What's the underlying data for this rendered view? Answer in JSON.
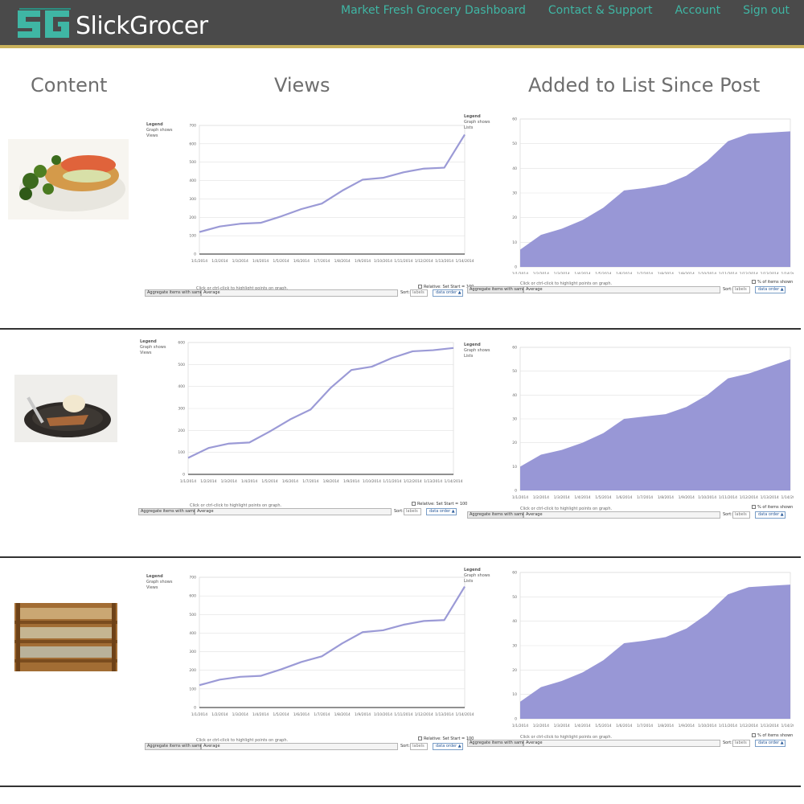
{
  "header": {
    "brand": "SlickGrocer",
    "nav": [
      "Market Fresh Grocery Dashboard",
      "Contact & Support",
      "Account",
      "Sign out"
    ]
  },
  "columns": {
    "content": "Content",
    "views": "Views",
    "lists": "Added to List Since Post"
  },
  "colors": {
    "header_bg": "#4a4a4a",
    "accent_teal": "#3fb6a4",
    "rule_gold": "#c9b15c",
    "views_line": "#9b9ad6",
    "lists_area": "#9897d6"
  },
  "views_legend": [
    "Legend",
    "Graph shows",
    "Views"
  ],
  "lists_legend": [
    "Legend",
    "Graph shows",
    "Lists"
  ],
  "controls": {
    "hint": "Click or ctrl-click to highlight points on graph.",
    "relative_label": "Relative: Set Start = 100",
    "percent_label": "% of items shown",
    "aggregate_label": "Aggregate items with same label:",
    "aggregate_value": "Average",
    "sort_label": "Sort:",
    "sort_value": "labels",
    "order_button": "data order ▲"
  },
  "rows": [
    {
      "thumbnail": "plated-dish-icon"
    },
    {
      "thumbnail": "dessert-plate-icon"
    },
    {
      "thumbnail": "cheese-shelves-icon"
    }
  ],
  "chart_data": [
    {
      "type": "line",
      "ylim": [
        0,
        700
      ],
      "yticks": [
        "0",
        "100",
        "200",
        "300",
        "400",
        "500",
        "600",
        "700"
      ],
      "x": [
        "1/1/2014",
        "1/2/2014",
        "1/3/2014",
        "1/4/2014",
        "1/5/2014",
        "1/6/2014",
        "1/7/2014",
        "1/8/2014",
        "1/9/2014",
        "1/10/2014",
        "1/11/2014",
        "1/12/2014",
        "1/13/2014",
        "1/14/2014"
      ],
      "values": [
        120,
        150,
        165,
        170,
        205,
        245,
        275,
        345,
        405,
        415,
        445,
        465,
        470,
        650
      ]
    },
    {
      "type": "area",
      "ylim": [
        0,
        60
      ],
      "yticks": [
        "0",
        "10",
        "20",
        "30",
        "40",
        "50",
        "60"
      ],
      "x": [
        "1/1/2014",
        "1/2/2014",
        "1/3/2014",
        "1/4/2014",
        "1/5/2014",
        "1/6/2014",
        "1/7/2014",
        "1/8/2014",
        "1/9/2014",
        "1/10/2014",
        "1/11/2014",
        "1/12/2014",
        "1/13/2014",
        "1/14/2014"
      ],
      "values": [
        7,
        13,
        15.5,
        19,
        24,
        31,
        32,
        33.5,
        37,
        43,
        51,
        54,
        54.5,
        55
      ]
    },
    {
      "type": "line",
      "ylim": [
        0,
        600
      ],
      "yticks": [
        "0",
        "100",
        "200",
        "300",
        "400",
        "500",
        "600"
      ],
      "x": [
        "1/1/2014",
        "1/2/2014",
        "1/3/2014",
        "1/4/2014",
        "1/5/2014",
        "1/6/2014",
        "1/7/2014",
        "1/8/2014",
        "1/9/2014",
        "1/10/2014",
        "1/11/2014",
        "1/12/2014",
        "1/13/2014",
        "1/14/2014"
      ],
      "values": [
        75,
        120,
        140,
        145,
        195,
        250,
        295,
        395,
        475,
        490,
        530,
        560,
        565,
        575
      ]
    },
    {
      "type": "area",
      "ylim": [
        0,
        60
      ],
      "yticks": [
        "0",
        "10",
        "20",
        "30",
        "40",
        "50",
        "60"
      ],
      "x": [
        "1/1/2014",
        "1/2/2014",
        "1/3/2014",
        "1/4/2014",
        "1/5/2014",
        "1/6/2014",
        "1/7/2014",
        "1/8/2014",
        "1/9/2014",
        "1/10/2014",
        "1/11/2014",
        "1/12/2014",
        "1/13/2014",
        "1/14/2014"
      ],
      "values": [
        10,
        15,
        17,
        20,
        24,
        30,
        31,
        32,
        35,
        40,
        47,
        49,
        52,
        55
      ]
    },
    {
      "type": "line",
      "ylim": [
        0,
        700
      ],
      "yticks": [
        "0",
        "100",
        "200",
        "300",
        "400",
        "500",
        "600",
        "700"
      ],
      "x": [
        "1/1/2014",
        "1/2/2014",
        "1/3/2014",
        "1/4/2014",
        "1/5/2014",
        "1/6/2014",
        "1/7/2014",
        "1/8/2014",
        "1/9/2014",
        "1/10/2014",
        "1/11/2014",
        "1/12/2014",
        "1/13/2014",
        "1/14/2014"
      ],
      "values": [
        120,
        150,
        165,
        170,
        205,
        245,
        275,
        345,
        405,
        415,
        445,
        465,
        470,
        650
      ]
    },
    {
      "type": "area",
      "ylim": [
        0,
        60
      ],
      "yticks": [
        "0",
        "10",
        "20",
        "30",
        "40",
        "50",
        "60"
      ],
      "x": [
        "1/1/2014",
        "1/2/2014",
        "1/3/2014",
        "1/4/2014",
        "1/5/2014",
        "1/6/2014",
        "1/7/2014",
        "1/8/2014",
        "1/9/2014",
        "1/10/2014",
        "1/11/2014",
        "1/12/2014",
        "1/13/2014",
        "1/14/2014"
      ],
      "values": [
        7,
        13,
        15.5,
        19,
        24,
        31,
        32,
        33.5,
        37,
        43,
        51,
        54,
        54.5,
        55
      ]
    }
  ]
}
